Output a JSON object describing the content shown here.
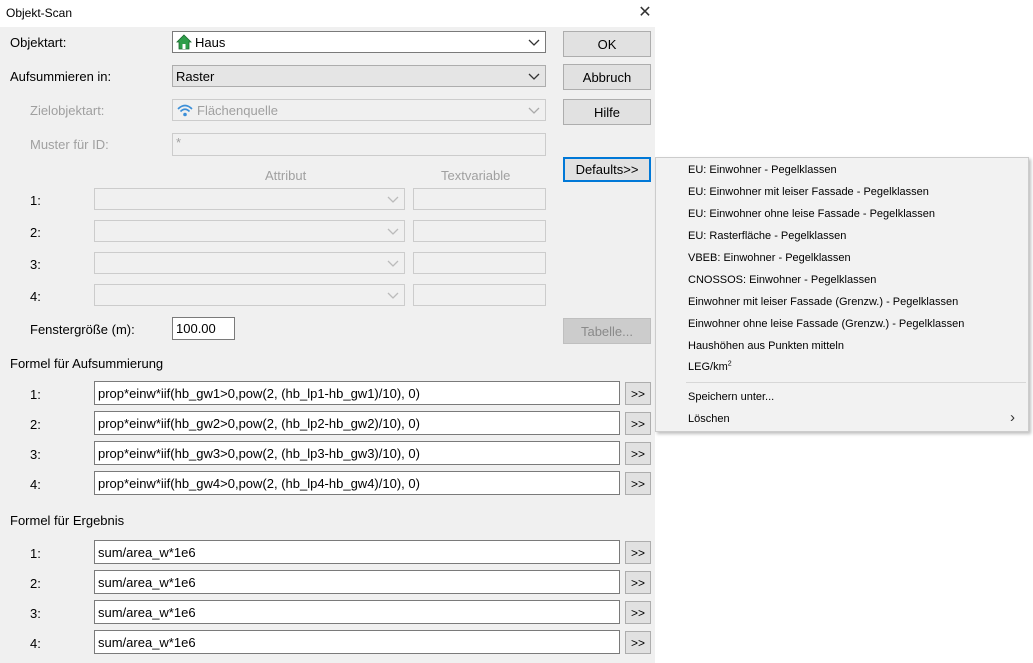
{
  "window": {
    "title": "Objekt-Scan",
    "close_glyph": "✕"
  },
  "objektart": {
    "label": "Objektart:",
    "value": "Haus",
    "icon": "house-icon"
  },
  "aufsummieren": {
    "label": "Aufsummieren in:",
    "value": "Raster"
  },
  "zielobjektart": {
    "label": "Zielobjektart:",
    "value": "Flächenquelle",
    "icon": "area-source-icon"
  },
  "muster": {
    "label": "Muster für ID:",
    "value": "*"
  },
  "attributes": {
    "header_attr": "Attribut",
    "header_text": "Textvariable",
    "rows": [
      {
        "label": "1:"
      },
      {
        "label": "2:"
      },
      {
        "label": "3:"
      },
      {
        "label": "4:"
      }
    ]
  },
  "fenster": {
    "label": "Fenstergröße (m):",
    "value": "100.00"
  },
  "buttons": {
    "ok": "OK",
    "abbruch": "Abbruch",
    "hilfe": "Hilfe",
    "defaults": "Defaults>>",
    "tabelle": "Tabelle..."
  },
  "formel_aufsummierung": {
    "title": "Formel für Aufsummierung",
    "rows": [
      {
        "label": "1:",
        "value": "prop*einw*iif(hb_gw1>0,pow(2, (hb_lp1-hb_gw1)/10), 0)",
        "btn": ">>"
      },
      {
        "label": "2:",
        "value": "prop*einw*iif(hb_gw2>0,pow(2, (hb_lp2-hb_gw2)/10), 0)",
        "btn": ">>"
      },
      {
        "label": "3:",
        "value": "prop*einw*iif(hb_gw3>0,pow(2, (hb_lp3-hb_gw3)/10), 0)",
        "btn": ">>"
      },
      {
        "label": "4:",
        "value": "prop*einw*iif(hb_gw4>0,pow(2, (hb_lp4-hb_gw4)/10), 0)",
        "btn": ">>"
      }
    ]
  },
  "formel_ergebnis": {
    "title": "Formel für Ergebnis",
    "rows": [
      {
        "label": "1:",
        "value": "sum/area_w*1e6",
        "btn": ">>"
      },
      {
        "label": "2:",
        "value": "sum/area_w*1e6",
        "btn": ">>"
      },
      {
        "label": "3:",
        "value": "sum/area_w*1e6",
        "btn": ">>"
      },
      {
        "label": "4:",
        "value": "sum/area_w*1e6",
        "btn": ">>"
      }
    ]
  },
  "defaults_menu": {
    "items": [
      "EU: Einwohner - Pegelklassen",
      "EU: Einwohner mit leiser Fassade - Pegelklassen",
      "EU: Einwohner ohne leise Fassade - Pegelklassen",
      "EU: Rasterfläche - Pegelklassen",
      "VBEB: Einwohner - Pegelklassen",
      "CNOSSOS: Einwohner - Pegelklassen",
      "Einwohner mit leiser Fassade (Grenzw.) - Pegelklassen",
      "Einwohner ohne leise Fassade (Grenzw.) - Pegelklassen",
      "Haushöhen aus Punkten mitteln"
    ],
    "leg_item": {
      "text": "LEG/km",
      "sup": "2"
    },
    "speichern": "Speichern unter...",
    "loeschen": "Löschen",
    "submenu_arrow": "›"
  },
  "colors": {
    "focus": "#0078d7",
    "dialog_bg": "#f0f0f0",
    "menu_bg": "#f2f2f2"
  }
}
